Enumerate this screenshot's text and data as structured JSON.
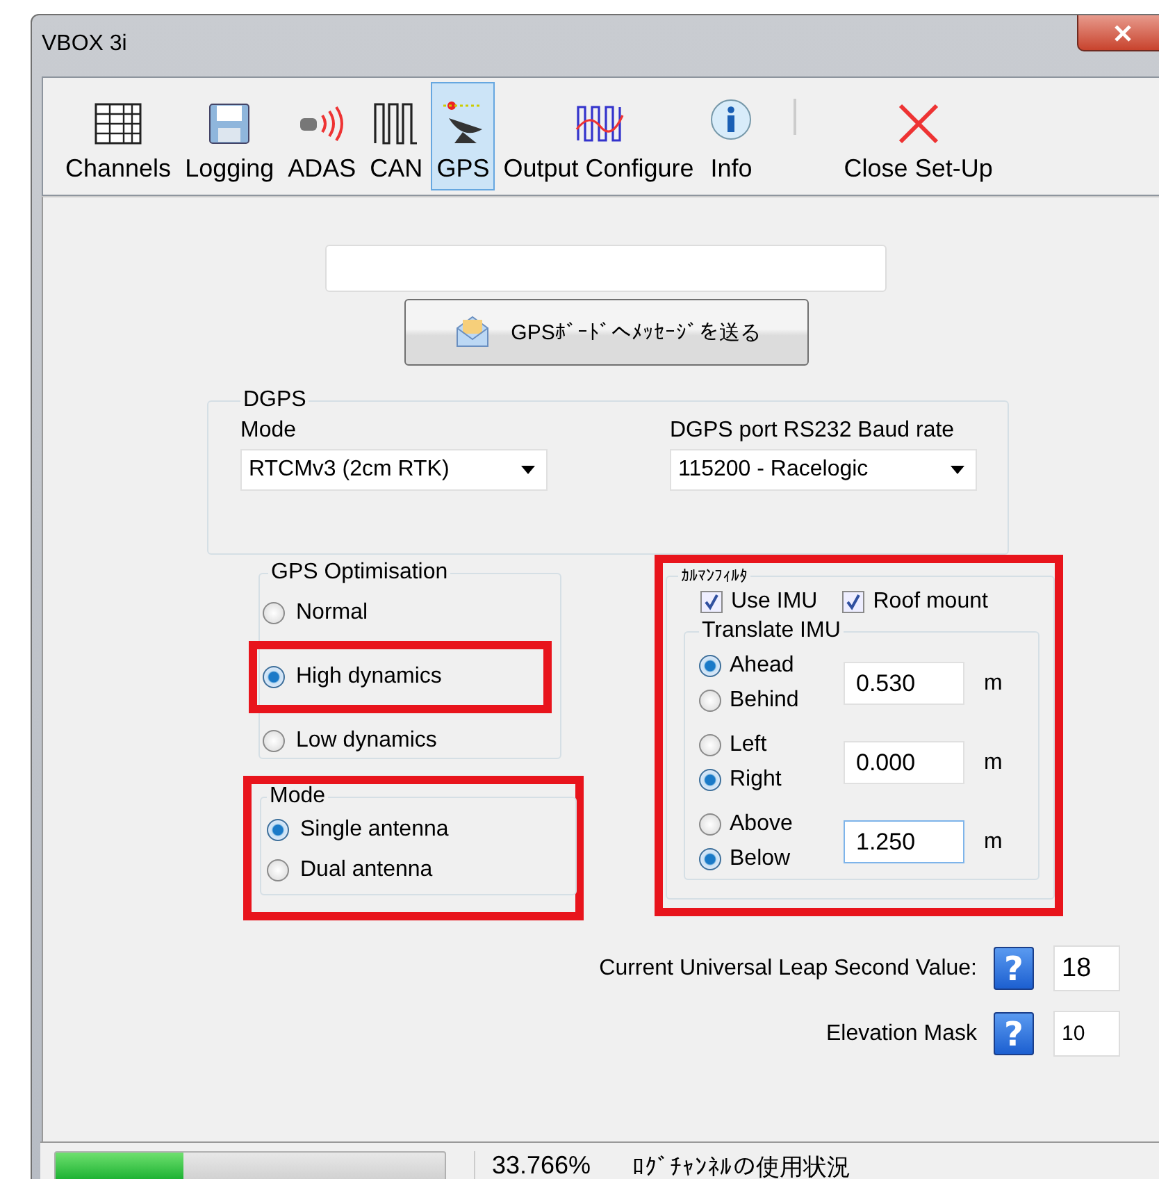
{
  "window": {
    "title": "VBOX 3i"
  },
  "toolbar": [
    {
      "kind": "tool",
      "label": "Channels",
      "selected": false
    },
    {
      "kind": "tool",
      "label": "Logging",
      "selected": false
    },
    {
      "kind": "tool",
      "label": "ADAS",
      "selected": false
    },
    {
      "kind": "tool",
      "label": "CAN",
      "selected": false
    },
    {
      "kind": "tool",
      "label": "GPS",
      "selected": true
    },
    {
      "kind": "tool",
      "label": "Output Configure",
      "selected": false
    },
    {
      "kind": "tool",
      "label": "Info",
      "selected": false
    },
    {
      "kind": "separator"
    },
    {
      "kind": "tool",
      "label": "Close Set-Up",
      "selected": false
    }
  ],
  "send_button": {
    "label": "GPSﾎﾞｰﾄﾞへﾒｯｾｰｼﾞを送る"
  },
  "dgps": {
    "title": "DGPS",
    "mode_label": "Mode",
    "mode_value": "RTCMv3 (2cm RTK)",
    "baud_label": "DGPS port RS232 Baud rate",
    "baud_value": "115200 - Racelogic"
  },
  "gps_optimisation": {
    "title": "GPS Optimisation",
    "options": [
      {
        "label": "Normal",
        "selected": false,
        "highlighted": false
      },
      {
        "label": "High dynamics",
        "selected": true,
        "highlighted": true
      },
      {
        "label": "Low dynamics",
        "selected": false,
        "highlighted": false
      }
    ]
  },
  "antenna_mode": {
    "title": "Mode",
    "highlighted": true,
    "options": [
      {
        "label": "Single antenna",
        "selected": true
      },
      {
        "label": "Dual antenna",
        "selected": false
      }
    ]
  },
  "kalman": {
    "title": "ｶﾙﾏﾝﾌｨﾙﾀ",
    "highlighted": true,
    "checkboxes": [
      {
        "label": "Use IMU",
        "checked": true
      },
      {
        "label": "Roof mount",
        "checked": true
      }
    ],
    "translate_imu": {
      "title": "Translate IMU",
      "axes": [
        {
          "options": [
            {
              "label": "Ahead",
              "selected": true
            },
            {
              "label": "Behind",
              "selected": false
            }
          ],
          "value": "0.530",
          "unit": "m",
          "focused": false
        },
        {
          "options": [
            {
              "label": "Left",
              "selected": false
            },
            {
              "label": "Right",
              "selected": true
            }
          ],
          "value": "0.000",
          "unit": "m",
          "focused": false
        },
        {
          "options": [
            {
              "label": "Above",
              "selected": false
            },
            {
              "label": "Below",
              "selected": true
            }
          ],
          "value": "1.250",
          "unit": "m",
          "focused": true
        }
      ]
    }
  },
  "settings": [
    {
      "label": "Current Universal Leap Second Value:",
      "help": "?",
      "value": "18"
    },
    {
      "label": "Elevation Mask",
      "help": "?",
      "value": "10"
    }
  ],
  "status_bar": {
    "level": 0.33,
    "percent": "33.766%",
    "text": "ﾛｸﾞﾁｬﾝﾈﾙの使用状況"
  }
}
